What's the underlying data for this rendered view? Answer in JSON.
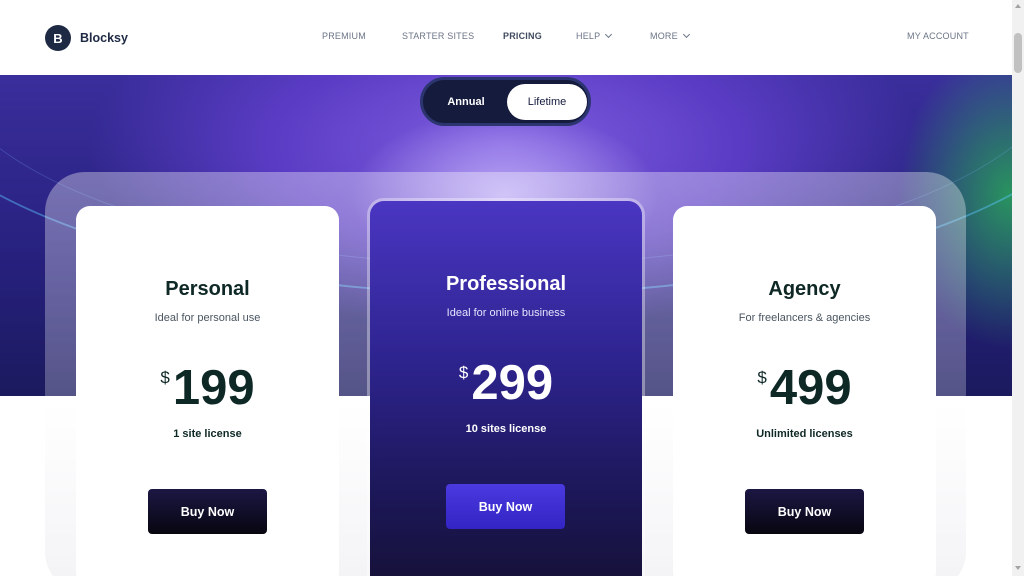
{
  "brand": {
    "logo_letter": "B",
    "name": "Blocksy"
  },
  "nav": {
    "items": [
      {
        "label": "PREMIUM"
      },
      {
        "label": "STARTER SITES"
      },
      {
        "label": "PRICING"
      },
      {
        "label": "HELP"
      },
      {
        "label": "MORE"
      }
    ],
    "account": "MY ACCOUNT"
  },
  "billing_toggle": {
    "options": [
      "Annual",
      "Lifetime"
    ],
    "selected": "Lifetime"
  },
  "plans": [
    {
      "name": "Personal",
      "description": "Ideal for personal use",
      "currency": "$",
      "price": "199",
      "license": "1 site license",
      "cta": "Buy Now"
    },
    {
      "name": "Professional",
      "description": "Ideal for online business",
      "currency": "$",
      "price": "299",
      "license": "10 sites license",
      "cta": "Buy Now"
    },
    {
      "name": "Agency",
      "description": "For freelancers & agencies",
      "currency": "$",
      "price": "499",
      "license": "Unlimited licenses",
      "cta": "Buy Now"
    }
  ],
  "colors": {
    "brand_dark": "#1e2a44",
    "accent_purple": "#3f2fd0",
    "button_dark": "#0b0a1a",
    "heading": "#0e2826"
  }
}
